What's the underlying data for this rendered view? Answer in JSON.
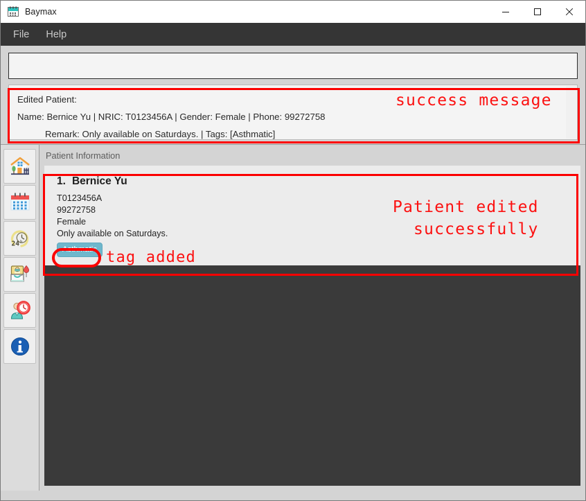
{
  "window": {
    "title": "Baymax",
    "icon": "calendar-app-icon",
    "controls": {
      "minimize": "minimize-icon",
      "maximize": "maximize-icon",
      "close": "close-icon"
    }
  },
  "menubar": {
    "items": [
      {
        "label": "File",
        "name": "menu-file"
      },
      {
        "label": "Help",
        "name": "menu-help"
      }
    ]
  },
  "command_box": {
    "value": "",
    "placeholder": ""
  },
  "result_display": {
    "lines": [
      "Edited Patient:",
      "Name: Bernice Yu | NRIC: T0123456A | Gender: Female | Phone: 99272758",
      "Remark: Only available on Saturdays. | Tags: [Asthmatic]"
    ]
  },
  "sidebar": {
    "items": [
      {
        "name": "sidebar-item-home",
        "icon": "house-icon"
      },
      {
        "name": "sidebar-item-calendar",
        "icon": "calendar-icon"
      },
      {
        "name": "sidebar-item-24h-clock",
        "icon": "clock-24h-icon"
      },
      {
        "name": "sidebar-item-patient-bed",
        "icon": "patient-iv-drip-icon"
      },
      {
        "name": "sidebar-item-staff-schedule",
        "icon": "person-clock-icon"
      },
      {
        "name": "sidebar-item-info",
        "icon": "info-circle-icon"
      }
    ]
  },
  "main": {
    "section_title": "Patient Information",
    "patients": [
      {
        "index": "1.",
        "name": "Bernice Yu",
        "nric": "T0123456A",
        "phone": "99272758",
        "gender": "Female",
        "remark": "Only available on Saturdays.",
        "tags": [
          "Asthmatic"
        ]
      }
    ]
  },
  "annotations": [
    {
      "name": "annotation-success-message",
      "text": "success message"
    },
    {
      "name": "annotation-patient-edited-line1",
      "text": "Patient edited"
    },
    {
      "name": "annotation-patient-edited-line2",
      "text": "successfully"
    },
    {
      "name": "annotation-tag-added",
      "text": "tag added"
    }
  ],
  "colors": {
    "annotation_red": "#fc0000",
    "menubar_bg": "#353535",
    "list_panel_bg": "#3a3a3a",
    "tag_bg": "#6fb7cc",
    "app_icon_teal": "#2cc4bf"
  }
}
